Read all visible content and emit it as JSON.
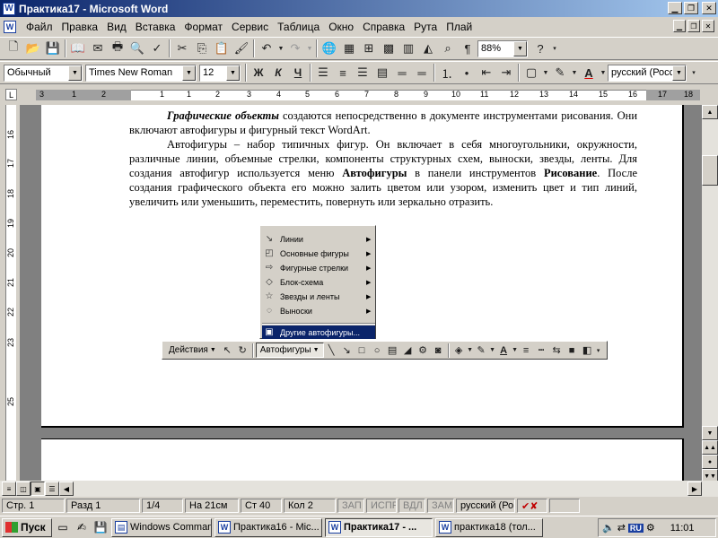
{
  "window": {
    "title": "Практика17 - Microsoft Word",
    "app_letter": "W"
  },
  "menu": [
    "Файл",
    "Правка",
    "Вид",
    "Вставка",
    "Формат",
    "Сервис",
    "Таблица",
    "Окно",
    "Справка",
    "Рута",
    "Плай"
  ],
  "standard_toolbar": {
    "zoom": "88%"
  },
  "format_toolbar": {
    "style": "Обычный",
    "font": "Times New Roman",
    "size": "12",
    "bold": "Ж",
    "italic": "К",
    "underline": "Ч",
    "language": "русский (Росси"
  },
  "ruler": {
    "h_ticks": [
      "3",
      "1",
      "2",
      "1",
      "1",
      "2",
      "3",
      "4",
      "5",
      "6",
      "7",
      "8",
      "9",
      "10",
      "11",
      "12",
      "13",
      "14",
      "15",
      "16",
      "17",
      "18"
    ],
    "v_ticks": [
      "16",
      "17",
      "18",
      "19",
      "20",
      "21",
      "22",
      "23",
      "25"
    ]
  },
  "document": {
    "p1_bold_italic": "Графические объекты",
    "p1_text": " создаются непосредственно в документе инструментами рисования. Они включают автофигуры и фигурный текст WordArt.",
    "p2_text1": "Автофигуры – набор типичных фигур. Он включает в себя многоугольники, окружности, различные линии, объемные стрелки, компоненты структурных схем, выноски, звезды, ленты. Для создания автофигур используется меню ",
    "p2_bold1": "Автофигуры",
    "p2_text2": " в панели инструментов ",
    "p2_bold2": "Рисование",
    "p2_text3": ". После создания графического объекта его можно  залить цветом или узором, изменить цвет и тип линий, увеличить или уменьшить, переместить, повернуть или зеркально отразить."
  },
  "autoshapes_menu": {
    "items": [
      {
        "label": "Линии",
        "icon": "↘"
      },
      {
        "label": "Основные фигуры",
        "icon": "◰"
      },
      {
        "label": "Фигурные стрелки",
        "icon": "⇨"
      },
      {
        "label": "Блок-схема",
        "icon": "◇"
      },
      {
        "label": "Звезды и ленты",
        "icon": "☆"
      },
      {
        "label": "Выноски",
        "icon": "◌"
      }
    ],
    "more": {
      "label": "Другие автофигуры...",
      "icon": "▣"
    }
  },
  "drawing_toolbar": {
    "actions": "Действия",
    "autoshapes": "Автофигуры"
  },
  "status": {
    "page": "Стр.  1",
    "section": "Разд  1",
    "pages": "1/4",
    "position": "На  21см",
    "line": "Ст  40",
    "column": "Кол  2",
    "rec": "ЗАП",
    "trk": "ИСПР",
    "ext": "ВДЛ",
    "ovr": "ЗАМ",
    "language": "русский (Ро"
  },
  "taskbar": {
    "start": "Пуск",
    "tasks": [
      {
        "label": "Windows Comman...",
        "icon": "▤"
      },
      {
        "label": "Практика16 - Mic...",
        "icon": "W"
      },
      {
        "label": "Практика17 - ...",
        "icon": "W"
      },
      {
        "label": "практика18 (тол...",
        "icon": "W"
      }
    ],
    "lang": "RU",
    "clock": "11:01"
  }
}
